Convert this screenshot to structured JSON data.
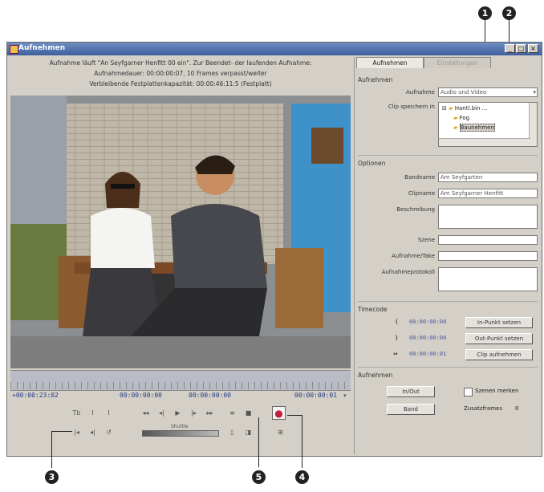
{
  "window": {
    "title": "Aufnehmen",
    "minimize": "_",
    "maximize": "□",
    "close": "×"
  },
  "info_lines": [
    "Aufnahme läuft \"An Seyfgarner Henfitt 00 ein\". Zur Beendet- der laufenden Aufnahme:",
    "Aufnahmedauer: 00:00:00:07, 10 Frames verpasst/weiter",
    "Verbleibende Festplattenkapazität: 00:00:46:11:5 (Festplatt)"
  ],
  "timecodes": {
    "left": "+00:00:23:02",
    "mid_start": "00:00:00:00",
    "mid_end": "00:00:00:00",
    "right": "00:00:00:01"
  },
  "controls": {
    "row1_left": [
      "Tb",
      "I",
      "I"
    ],
    "transport": [
      "◂◂",
      "◂|",
      "▶",
      "|▸",
      "▸▸"
    ],
    "row1_right": [
      "≡",
      "■",
      "●"
    ],
    "row2_left": [
      "|◂",
      "◂|",
      "↺"
    ],
    "shuttle_label": "Shuttle",
    "row2_right": [
      "▯",
      "◨",
      "⊞"
    ]
  },
  "panel": {
    "tabs": [
      "Aufnehmen",
      "Einstellungen"
    ],
    "section_record": "Aufnehmen",
    "record_label": "Aufnahme",
    "record_value": "Audio und Video",
    "save_label": "Clip speichern in",
    "tree": [
      "Hantl.bin ...",
      "Fog",
      "Baunehmen"
    ],
    "section_options": "Optionen",
    "fields": [
      {
        "label": "Bandname",
        "value": "Am Seyfgarten"
      },
      {
        "label": "Clipname",
        "value": "Am Seyfgarner Henfitt"
      },
      {
        "label": "Beschreibung",
        "value": ""
      },
      {
        "label": "Szene",
        "value": ""
      },
      {
        "label": "Aufnahme/Take",
        "value": ""
      },
      {
        "label": "Aufnahmeprotokoll",
        "value": ""
      }
    ],
    "section_timecode": "Timecode",
    "timecode_rows": [
      {
        "sym": "{",
        "value": "00:00:00:00",
        "button": "In-Punkt setzen"
      },
      {
        "sym": "}",
        "value": "00:00:00:00",
        "button": "Out-Punkt setzen"
      },
      {
        "sym": "⇔",
        "value": "00:00:00:01",
        "button": "Clip aufnehmen"
      }
    ],
    "section_capture": "Aufnehmen",
    "capture_buttons": [
      "In/Out",
      "Band"
    ],
    "scene_check": "Szenen merken",
    "handles_label": "Zusatzframes",
    "handles_value": "0"
  },
  "callouts": [
    "1",
    "2",
    "3",
    "4",
    "5"
  ]
}
